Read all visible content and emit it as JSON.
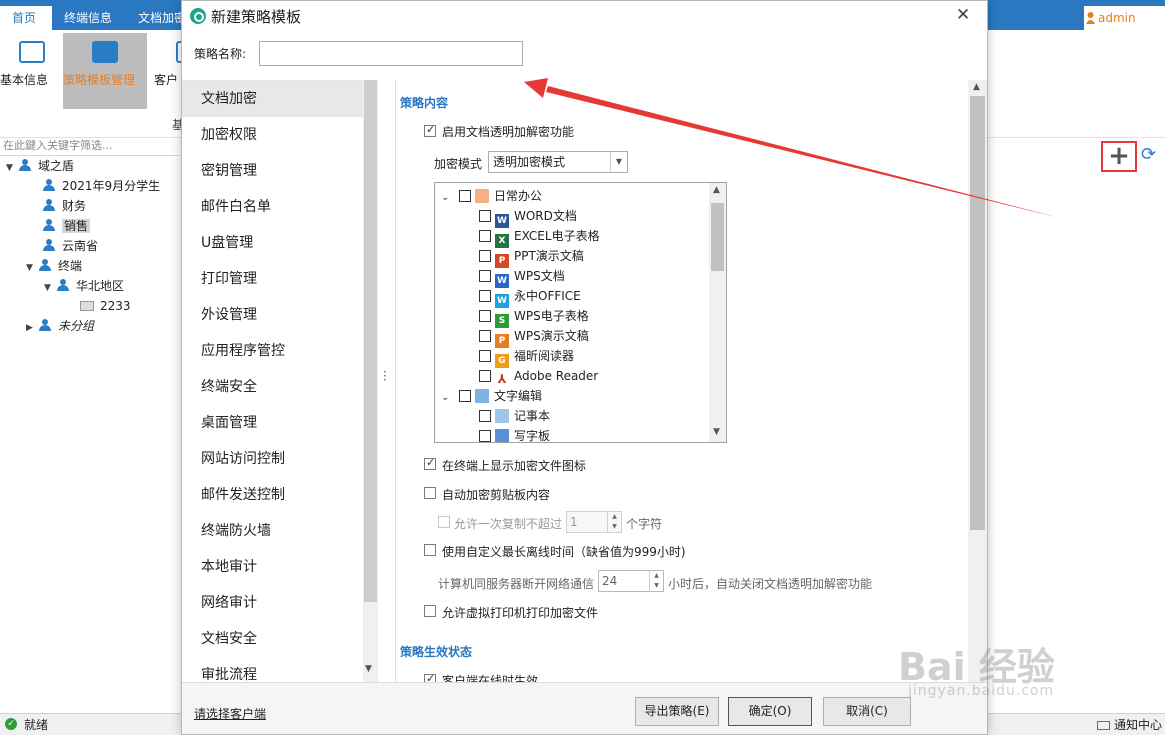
{
  "top_nav": {
    "tabs": [
      "首页",
      "终端信息",
      "文档加密"
    ],
    "user": "admin"
  },
  "ribbon": {
    "buttons": [
      "基本信息",
      "策略模板管理",
      "客户"
    ],
    "group_label": "基"
  },
  "filter": {
    "placeholder": "在此鍵入关键字筛选..."
  },
  "org_tree": {
    "root": "域之盾",
    "items": [
      "2021年9月分学生",
      "财务",
      "销售",
      "云南省"
    ],
    "terminal_group": "终端",
    "region": "华北地区",
    "computer": "2233",
    "ungrouped": "未分组"
  },
  "dialog": {
    "title": "新建策略模板",
    "name_label": "策略名称:",
    "name_value": "",
    "menu": [
      "文档加密",
      "加密权限",
      "密钥管理",
      "邮件白名单",
      "U盘管理",
      "打印管理",
      "外设管理",
      "应用程序管控",
      "终端安全",
      "桌面管理",
      "网站访问控制",
      "邮件发送控制",
      "终端防火墙",
      "本地审计",
      "网络审计",
      "文档安全",
      "审批流程"
    ],
    "content": {
      "section1": "策略内容",
      "enable_label": "启用文档透明加解密功能",
      "mode_label": "加密模式",
      "mode_value": "透明加密模式",
      "app_tree": {
        "group1": "日常办公",
        "group1_items": [
          "WORD文档",
          "EXCEL电子表格",
          "PPT演示文稿",
          "WPS文档",
          "永中OFFICE",
          "WPS电子表格",
          "WPS演示文稿",
          "福昕阅读器",
          "Adobe Reader"
        ],
        "group2": "文字编辑",
        "group2_items": [
          "记事本",
          "写字板"
        ]
      },
      "show_icon_label": "在终端上显示加密文件图标",
      "auto_clipboard_label": "自动加密剪贴板内容",
      "allow_copy_label": "允许一次复制不超过",
      "allow_copy_value": "1",
      "allow_copy_unit": "个字符",
      "offline_label": "使用自定义最长离线时间（缺省值为999小时)",
      "offline_desc_prefix": "计算机同服务器断开网络通信",
      "offline_value": "24",
      "offline_desc_suffix": "小时后，自动关闭文档透明加解密功能",
      "virtual_printer_label": "允许虚拟打印机打印加密文件",
      "section2": "策略生效状态",
      "online_label": "客户端在线时生效"
    },
    "footer": {
      "select_client": "请选择客户端",
      "export": "导出策略(E)",
      "ok": "确定(O)",
      "cancel": "取消(C)"
    }
  },
  "status_bar": {
    "ready": "就绪",
    "notify": "通知中心"
  },
  "watermark": {
    "main": "Bai 经验",
    "sub": "jingyan.baidu.com"
  },
  "colors": {
    "accent": "#2a78c2",
    "active_orange": "#e67e22",
    "annotation_red": "#e53935"
  },
  "icons": {
    "add": "plus-icon",
    "refresh": "refresh-icon",
    "close": "close-icon"
  }
}
